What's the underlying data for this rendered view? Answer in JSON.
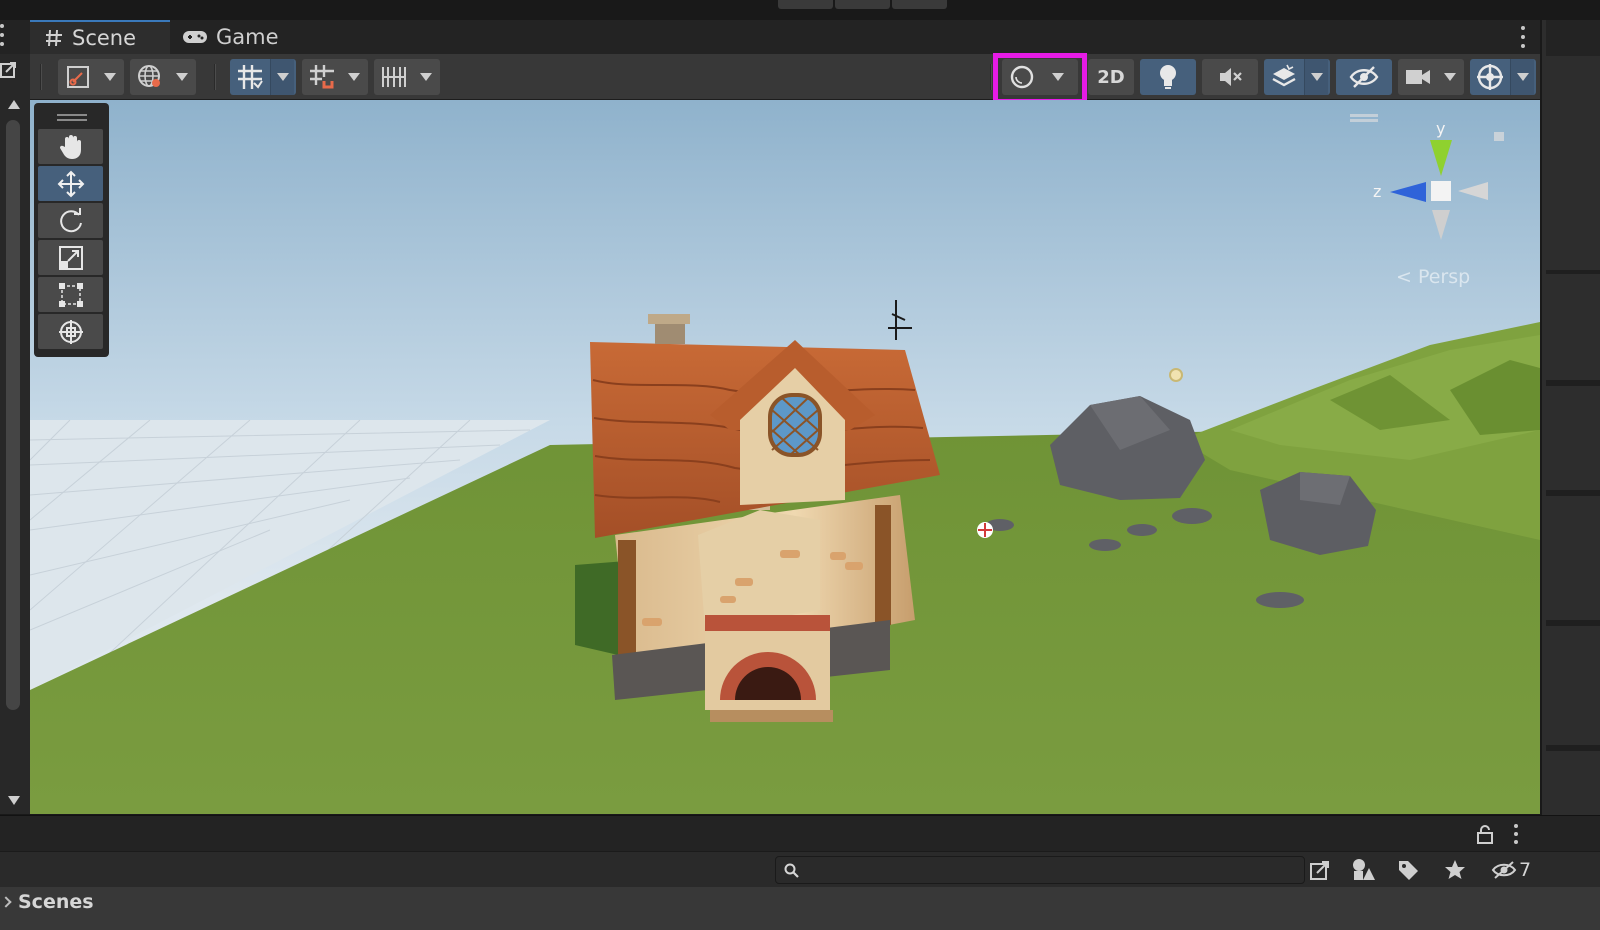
{
  "tabs": [
    {
      "label": "Scene",
      "icon": "hash-icon",
      "active": true
    },
    {
      "label": "Game",
      "icon": "gamepad-icon",
      "active": false
    }
  ],
  "toolbar": {
    "mode_2d_label": "2D",
    "accent_active": "#46607c",
    "highlight_color": "#e61be6"
  },
  "viewport": {
    "persp_label": "< Persp",
    "gizmo_axes": {
      "y": "y",
      "z": "z"
    }
  },
  "tools": [
    {
      "name": "hand-tool",
      "active": false
    },
    {
      "name": "move-tool",
      "active": true
    },
    {
      "name": "rotate-tool",
      "active": false
    },
    {
      "name": "scale-tool",
      "active": false
    },
    {
      "name": "rect-tool",
      "active": false
    },
    {
      "name": "transform-tool",
      "active": false
    }
  ],
  "bottom": {
    "search_placeholder": "",
    "hidden_count": "7",
    "scenes_label": "Scenes"
  }
}
